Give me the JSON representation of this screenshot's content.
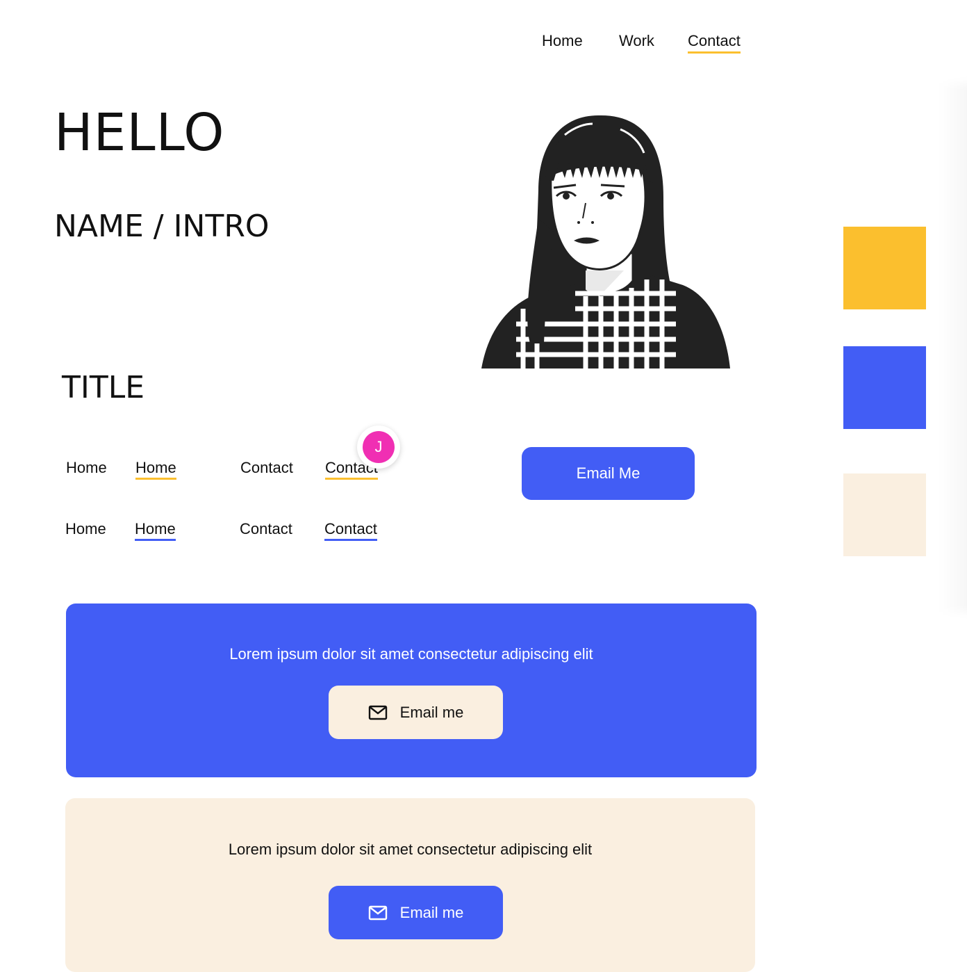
{
  "top_nav": {
    "items": [
      {
        "label": "Home"
      },
      {
        "label": "Work"
      },
      {
        "label": "Contact"
      }
    ]
  },
  "hero": {
    "hello": "HELLO",
    "intro": "NAME / INTRO",
    "title": "TITLE"
  },
  "nav_variants": {
    "row1": [
      "Home",
      "Home",
      "Contact",
      "Contact"
    ],
    "row2": [
      "Home",
      "Home",
      "Contact",
      "Contact"
    ]
  },
  "avatar": {
    "initial": "J",
    "color": "#f02fb3"
  },
  "email_button": {
    "label": "Email Me"
  },
  "palette": {
    "colors": [
      "#fbbf2e",
      "#425df5",
      "#faefe0"
    ]
  },
  "cards": [
    {
      "text": "Lorem ipsum dolor sit amet consectetur adipiscing elit",
      "button_label": "Email me",
      "icon": "mail-icon",
      "background": "#425df5",
      "button_background": "#faefe0"
    },
    {
      "text": "Lorem ipsum dolor sit amet consectetur adipiscing elit",
      "button_label": "Email me",
      "icon": "mail-icon",
      "background": "#faefe0",
      "button_background": "#425df5"
    }
  ]
}
